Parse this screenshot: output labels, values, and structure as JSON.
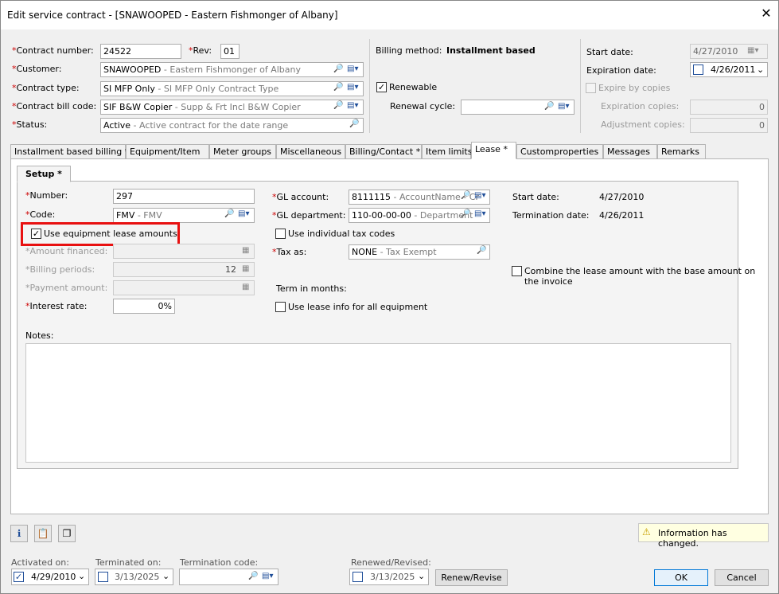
{
  "window": {
    "title": "Edit service contract - [SNAWOOPED - Eastern Fishmonger of Albany]",
    "close": "✕"
  },
  "header": {
    "contract_number_label": "Contract number:",
    "contract_number": "24522",
    "rev_label": "Rev:",
    "rev": "01",
    "customer_label": "Customer:",
    "customer_code": "SNAWOOPED",
    "customer_desc": " - Eastern Fishmonger of Albany",
    "contract_type_label": "Contract type:",
    "contract_type_code": "SI MFP Only",
    "contract_type_desc": " - SI MFP Only Contract Type",
    "bill_code_label": "Contract bill code:",
    "bill_code": "SIF B&W Copier",
    "bill_code_desc": " - Supp & Frt Incl B&W Copier",
    "status_label": "Status:",
    "status_code": "Active",
    "status_desc": " - Active contract for the date range",
    "req": "*"
  },
  "billing": {
    "method_label": "Billing method:",
    "method_value": "Installment based",
    "renewable_label": "Renewable",
    "renewal_cycle_label": "Renewal cycle:",
    "renewable_check": "✓"
  },
  "dates": {
    "start_label": "Start date:",
    "start_value": "4/27/2010",
    "expiration_label": "Expiration date:",
    "expiration_value": "4/26/2011",
    "expire_by_copies_label": "Expire by copies",
    "expiration_copies_label": "Expiration copies:",
    "expiration_copies": "0",
    "adjustment_copies_label": "Adjustment copies:",
    "adjustment_copies": "0"
  },
  "tabs": [
    "Installment based billing *",
    "Equipment/Item",
    "Meter groups",
    "Miscellaneous",
    "Billing/Contact *",
    "Item limits",
    "Lease *",
    "Customproperties",
    "Messages",
    "Remarks"
  ],
  "subtab": "Setup  *",
  "lease": {
    "number_label": "Number:",
    "number": "297",
    "code_label": "Code:",
    "code_value": "FMV",
    "code_desc": " - FMV",
    "use_equipment_label": "Use equipment lease amounts",
    "use_equipment_check": "✓",
    "amount_financed_label": "*Amount financed:",
    "billing_periods_label": "*Billing periods:",
    "billing_periods": "12",
    "payment_amount_label": "*Payment amount:",
    "interest_rate_label": "Interest rate:",
    "interest_rate": "0%",
    "gl_account_label": "GL account:",
    "gl_account": "8111115",
    "gl_account_desc": " - AccountName - Cr",
    "gl_department_label": "GL department:",
    "gl_department": "110-00-00-00",
    "gl_department_desc": " - Department",
    "individual_tax_label": "Use individual tax codes",
    "tax_as_label": "Tax as:",
    "tax_as": "NONE",
    "tax_as_desc": " - Tax Exempt",
    "term_label": "Term in months:",
    "lease_info_label": "Use lease info for all equipment",
    "start_label": "Start date:",
    "start_value": "4/27/2010",
    "termination_label": "Termination date:",
    "termination_value": "4/26/2011",
    "combine_label_1": "Combine the lease amount with the base amount on",
    "combine_label_2": "the invoice",
    "notes_label": "Notes:"
  },
  "footer": {
    "info_changed": "Information has changed.",
    "activated_label": "Activated on:",
    "activated_value": "4/29/2010",
    "activated_check": "✓",
    "terminated_label": "Terminated on:",
    "terminated_value": "3/13/2025",
    "termination_code_label": "Termination code:",
    "renewed_label": "Renewed/Revised:",
    "renewed_value": "3/13/2025",
    "renew_button": "Renew/Revise",
    "ok_button": "OK",
    "cancel_button": "Cancel"
  }
}
